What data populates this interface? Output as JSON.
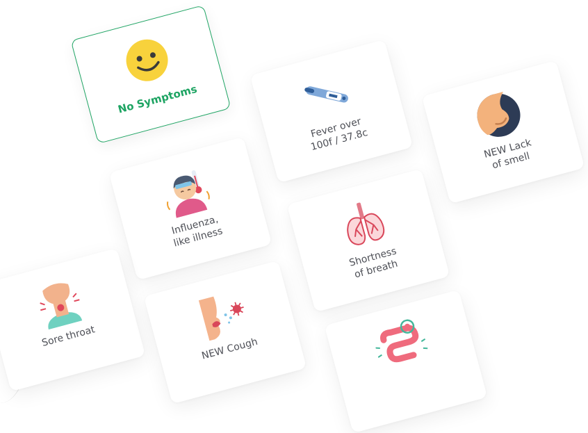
{
  "cards": [
    {
      "label": "No Symptoms",
      "icon": "smiley-face-icon",
      "selected": true
    },
    {
      "label": "Fever over\n100f / 37.8c",
      "icon": "thermometer-icon",
      "selected": false
    },
    {
      "label": "NEW Lack\nof smell",
      "icon": "nose-icon",
      "selected": false
    },
    {
      "label": "Influenza,\nlike illness",
      "icon": "sick-person-icon",
      "selected": false
    },
    {
      "label": "Shortness\nof breath",
      "icon": "lungs-icon",
      "selected": false
    },
    {
      "label": "Sore throat",
      "icon": "sore-throat-icon",
      "selected": false
    },
    {
      "label": "NEW Cough",
      "icon": "cough-icon",
      "selected": false
    },
    {
      "label": "",
      "icon": "intestines-icon",
      "selected": false
    }
  ],
  "colors": {
    "selected_border": "#1ea463",
    "selected_text": "#1ea463",
    "text": "#4d4f56"
  }
}
